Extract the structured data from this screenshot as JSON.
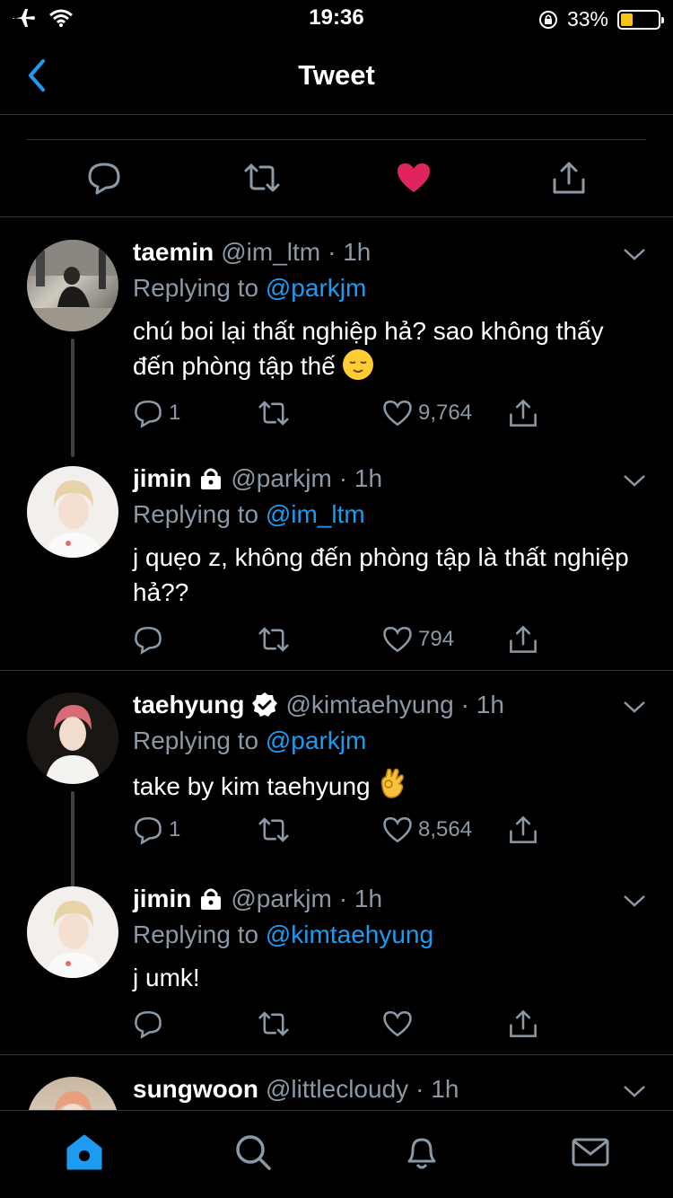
{
  "status_bar": {
    "time": "19:36",
    "battery": "33%",
    "battery_level": 0.33
  },
  "nav": {
    "title": "Tweet"
  },
  "colors": {
    "accent": "#1d9bf0",
    "like": "#e0245e",
    "muted": "#8b98a5",
    "divider": "#2f3336",
    "battery_fill": "#f5c518"
  },
  "icons": {
    "top_actions": [
      "reply-icon",
      "retweet-icon",
      "like-filled-icon",
      "share-icon"
    ],
    "tabs": [
      "home-icon",
      "search-icon",
      "notifications-icon",
      "messages-icon"
    ]
  },
  "tweets": [
    {
      "name": "taemin",
      "handle": "@im_ltm",
      "time": "· 1h",
      "replying_prefix": "Replying to",
      "replying_to": "@parkjm",
      "text": "chú boi lại thất nghiệp hả? sao không thấy đến phòng tập thế",
      "replies": "1",
      "likes": "9,764"
    },
    {
      "name": "jimin",
      "handle": "@parkjm",
      "time": "· 1h",
      "replying_prefix": "Replying to",
      "replying_to": "@im_ltm",
      "text": "j quẹo z, không đến phòng tập là thất nghiệp hả??",
      "replies": "",
      "likes": "794"
    },
    {
      "name": "taehyung",
      "handle": "@kimtaehyung",
      "time": "· 1h",
      "replying_prefix": "Replying to",
      "replying_to": "@parkjm",
      "text": "take by kim taehyung",
      "replies": "1",
      "likes": "8,564"
    },
    {
      "name": "jimin",
      "handle": "@parkjm",
      "time": "· 1h",
      "replying_prefix": "Replying to",
      "replying_to": "@kimtaehyung",
      "text": "j umk!",
      "replies": "",
      "likes": ""
    },
    {
      "name": "sungwoon",
      "handle": "@littlecloudy",
      "time": "· 1h"
    }
  ]
}
